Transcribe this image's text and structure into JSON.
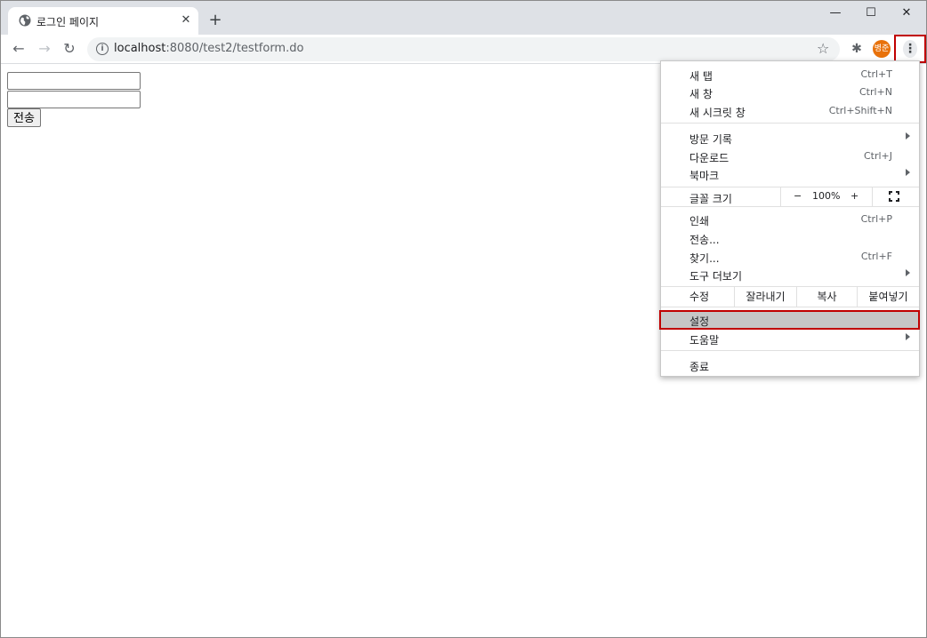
{
  "tab": {
    "title": "로그인 페이지",
    "close": "✕",
    "new_tab": "+"
  },
  "window_controls": {
    "minimize": "—",
    "maximize": "☐",
    "close": "✕"
  },
  "toolbar": {
    "back": "←",
    "forward": "→",
    "reload": "↻",
    "url_host": "localhost",
    "url_path": ":8080/test2/testform.do",
    "star": "☆",
    "extensions": "✱",
    "avatar": "병준",
    "menu": "⋮"
  },
  "form": {
    "input1_value": "",
    "input2_value": "",
    "submit_label": "전송"
  },
  "menu": {
    "new_tab": {
      "label": "새 탭",
      "shortcut": "Ctrl+T"
    },
    "new_window": {
      "label": "새 창",
      "shortcut": "Ctrl+N"
    },
    "incognito": {
      "label": "새 시크릿 창",
      "shortcut": "Ctrl+Shift+N"
    },
    "history": {
      "label": "방문 기록"
    },
    "downloads": {
      "label": "다운로드",
      "shortcut": "Ctrl+J"
    },
    "bookmarks": {
      "label": "북마크"
    },
    "zoom": {
      "label": "글꼴 크기",
      "minus": "−",
      "value": "100%",
      "plus": "+"
    },
    "print": {
      "label": "인쇄",
      "shortcut": "Ctrl+P"
    },
    "cast": {
      "label": "전송..."
    },
    "find": {
      "label": "찾기...",
      "shortcut": "Ctrl+F"
    },
    "more_tools": {
      "label": "도구 더보기"
    },
    "edit": {
      "label": "수정",
      "cut": "잘라내기",
      "copy": "복사",
      "paste": "붙여넣기"
    },
    "settings": {
      "label": "설정"
    },
    "help": {
      "label": "도움말"
    },
    "exit": {
      "label": "종료"
    }
  }
}
